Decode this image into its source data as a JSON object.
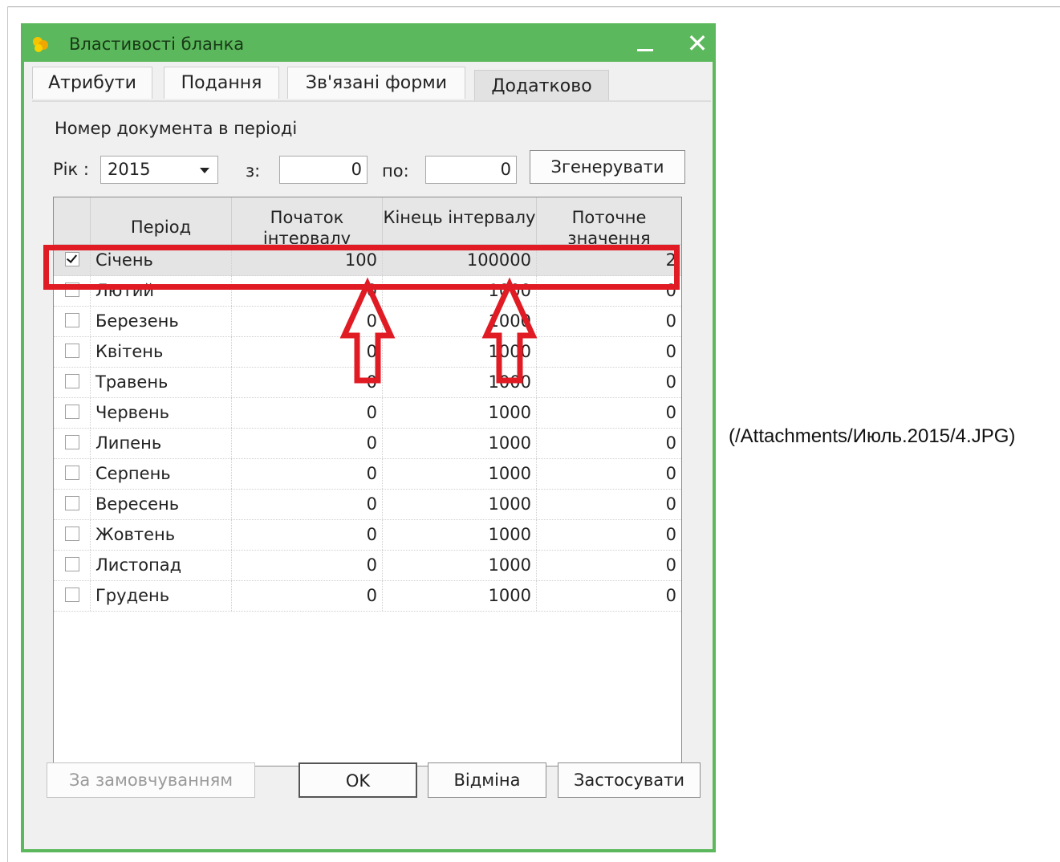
{
  "window": {
    "title": "Властивості бланка"
  },
  "tabs": [
    {
      "label": "Атрибути"
    },
    {
      "label": "Подання"
    },
    {
      "label": "Зв'язані форми"
    },
    {
      "label": "Додатково"
    }
  ],
  "section": {
    "title": "Номер документа в періоді",
    "year_label": "Рік :",
    "year_value": "2015",
    "from_label": "з:",
    "from_value": "0",
    "to_label": "по:",
    "to_value": "0",
    "generate_label": "Згенерувати"
  },
  "table": {
    "columns": [
      "Період",
      "Початок інтервалу",
      "Кінець інтервалу",
      "Поточне значення"
    ],
    "rows": [
      {
        "checked": true,
        "period": "Січень",
        "start": "100",
        "end": "100000",
        "current": "2"
      },
      {
        "checked": false,
        "period": "Лютий",
        "start": "0",
        "end": "1000",
        "current": "0"
      },
      {
        "checked": false,
        "period": "Березень",
        "start": "0",
        "end": "1000",
        "current": "0"
      },
      {
        "checked": false,
        "period": "Квітень",
        "start": "0",
        "end": "1000",
        "current": "0"
      },
      {
        "checked": false,
        "period": "Травень",
        "start": "0",
        "end": "1000",
        "current": "0"
      },
      {
        "checked": false,
        "period": "Червень",
        "start": "0",
        "end": "1000",
        "current": "0"
      },
      {
        "checked": false,
        "period": "Липень",
        "start": "0",
        "end": "1000",
        "current": "0"
      },
      {
        "checked": false,
        "period": "Серпень",
        "start": "0",
        "end": "1000",
        "current": "0"
      },
      {
        "checked": false,
        "period": "Вересень",
        "start": "0",
        "end": "1000",
        "current": "0"
      },
      {
        "checked": false,
        "period": "Жовтень",
        "start": "0",
        "end": "1000",
        "current": "0"
      },
      {
        "checked": false,
        "period": "Листопад",
        "start": "0",
        "end": "1000",
        "current": "0"
      },
      {
        "checked": false,
        "period": "Грудень",
        "start": "0",
        "end": "1000",
        "current": "0"
      }
    ]
  },
  "buttons": {
    "defaults": "За замовчуванням",
    "ok": "OK",
    "cancel": "Відміна",
    "apply": "Застосувати"
  },
  "caption": "(/Attachments/Июль.2015/4.JPG)",
  "colors": {
    "dialog_border": "#5cb85c",
    "highlight": "#e01b24"
  }
}
